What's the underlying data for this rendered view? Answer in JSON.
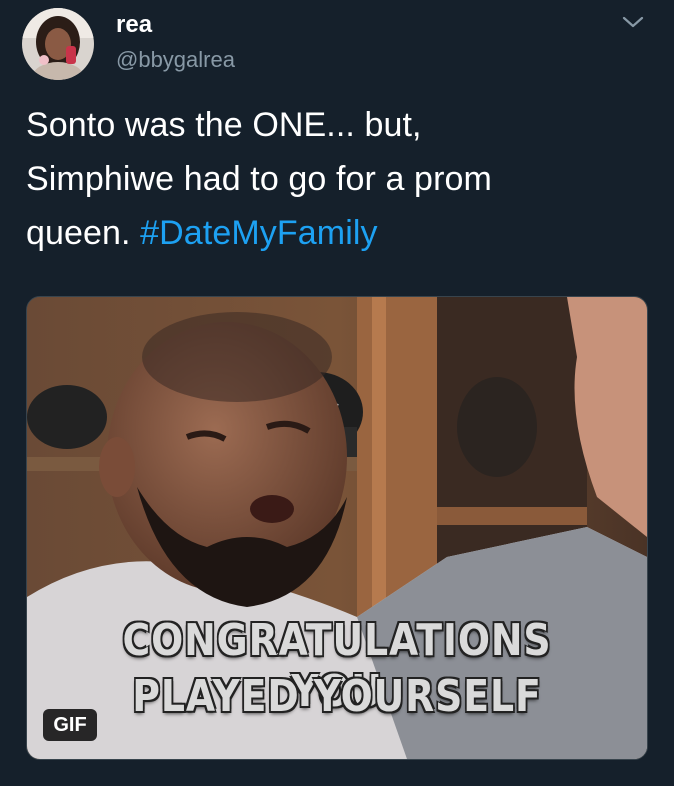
{
  "user": {
    "display_name": "rea",
    "handle": "@bbygalrea"
  },
  "tweet": {
    "text_line1": "Sonto was the ONE... but,",
    "text_line2": "Simphiwe had to go for a prom",
    "text_line3_prefix": "queen. ",
    "hashtag": "#DateMyFamily"
  },
  "media": {
    "caption_line1": "CONGRATULATIONS YOU",
    "caption_line2": "PLAYED YOURSELF",
    "badge": "GIF"
  },
  "colors": {
    "background": "#15202b",
    "text": "#ffffff",
    "secondary_text": "#8899a6",
    "link": "#1da1f2"
  },
  "icons": {
    "menu": "chevron-down-icon"
  }
}
